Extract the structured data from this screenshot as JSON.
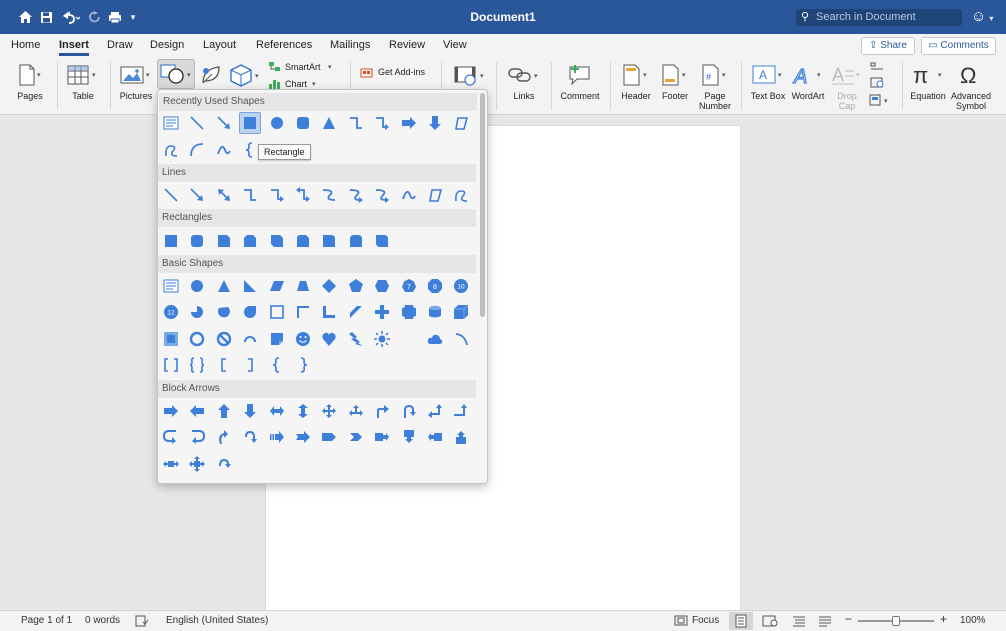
{
  "window": {
    "title": "Document1"
  },
  "search": {
    "placeholder": "Search in Document"
  },
  "tabs": [
    "Home",
    "Insert",
    "Draw",
    "Design",
    "Layout",
    "References",
    "Mailings",
    "Review",
    "View"
  ],
  "active_tab": "Insert",
  "share_label": "Share",
  "comments_label": "Comments",
  "ribbon": {
    "pages": "Pages",
    "table": "Table",
    "pictures": "Pictures",
    "smartart": "SmartArt",
    "chart": "Chart",
    "get_addins": "Get Add-ins",
    "links": "Links",
    "comment": "Comment",
    "header": "Header",
    "footer": "Footer",
    "page_number": "Page Number",
    "text_box": "Text Box",
    "wordart": "WordArt",
    "drop_cap": "Drop Cap",
    "equation": "Equation",
    "advanced_symbol": "Advanced Symbol"
  },
  "shapes_panel": {
    "sections": {
      "recent": "Recently Used Shapes",
      "lines": "Lines",
      "rectangles": "Rectangles",
      "basic": "Basic Shapes",
      "arrows": "Block Arrows"
    },
    "tooltip": "Rectangle"
  },
  "status": {
    "page": "Page 1 of 1",
    "words": "0 words",
    "language": "English (United States)",
    "focus": "Focus",
    "zoom": "100%"
  },
  "colors": {
    "accent": "#2a579a",
    "shape_blue": "#3d7fd9"
  }
}
